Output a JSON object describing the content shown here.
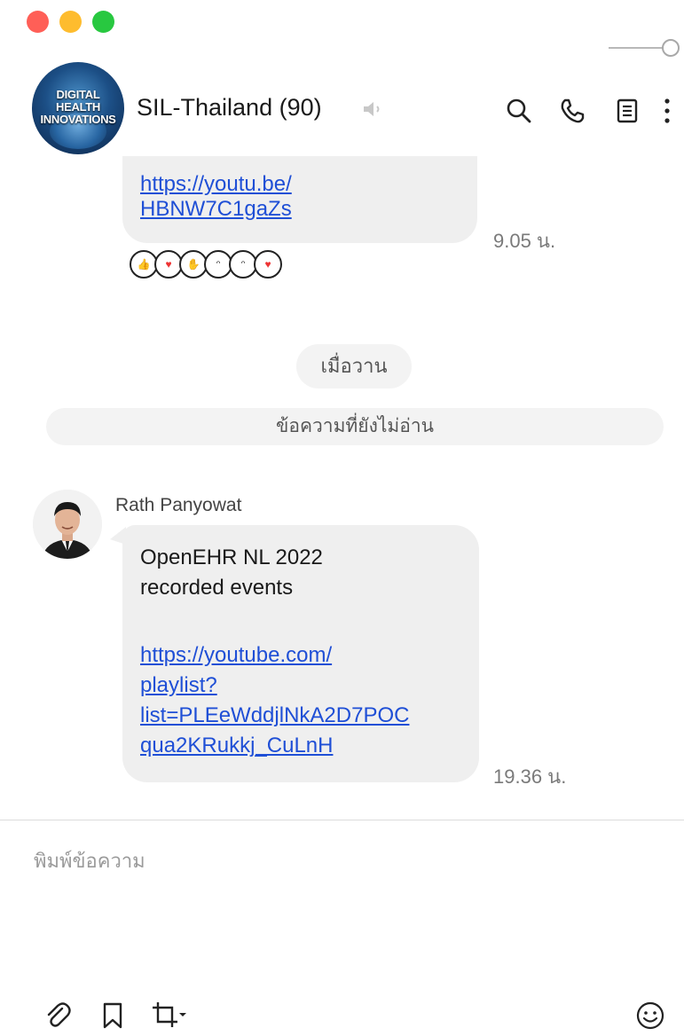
{
  "window": {
    "controls": [
      "close",
      "minimize",
      "zoom"
    ],
    "opacity_slider": {
      "value": 1.0
    }
  },
  "header": {
    "chat_name": "SIL-Thailand (90)",
    "avatar_text": "DIGITAL HEALTH INNOVATIONS",
    "icons": [
      "search-icon",
      "phone-icon",
      "notes-icon",
      "more-icon",
      "speaker-muted-icon"
    ]
  },
  "messages": {
    "first": {
      "link": "https://youtu.be/\nHBNW7C1gaZs",
      "time": "9.05 น.",
      "stickers": [
        "thumbs-up-face",
        "heart-eyes-face",
        "clap-face",
        "wink-face",
        "wink-face",
        "heart-eyes-face"
      ]
    },
    "date_separator": "เมื่อวาน",
    "unread_label": "ข้อความที่ยังไม่อ่าน",
    "second": {
      "sender": "Rath Panyowat",
      "text": "OpenEHR NL 2022\nrecorded events",
      "link": "https://youtube.com/\nplaylist?\nlist=PLEeWddjlNkA2D7POC\nqua2KRukkj_CuLnH",
      "time": "19.36 น."
    }
  },
  "composer": {
    "placeholder": "พิมพ์ข้อความ",
    "tools": [
      "attach-icon",
      "bookmark-icon",
      "crop-icon",
      "emoji-icon"
    ]
  }
}
